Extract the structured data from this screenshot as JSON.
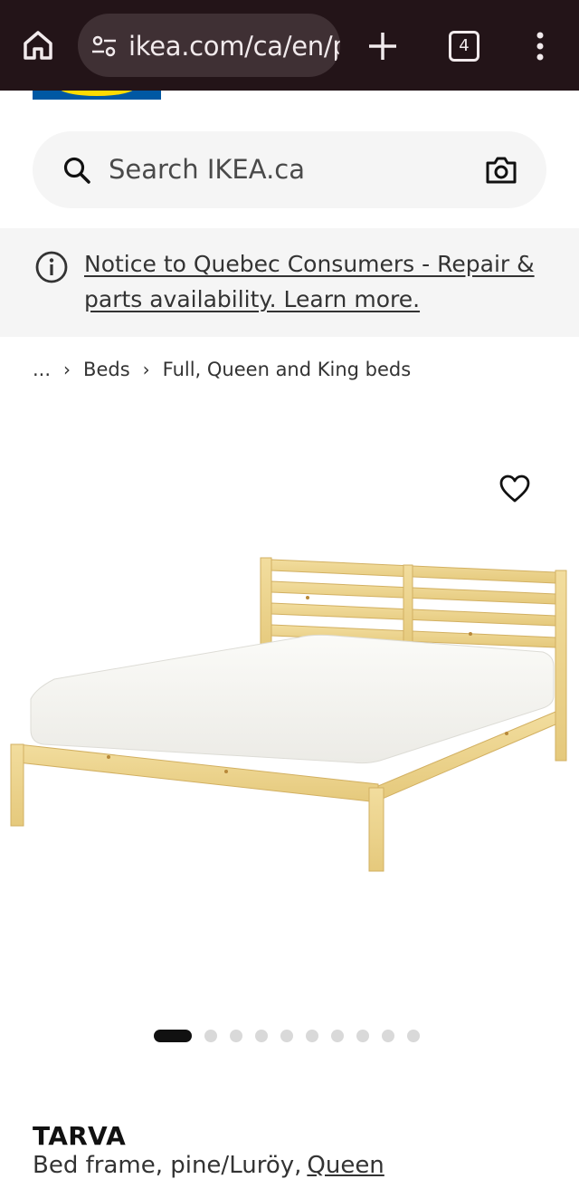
{
  "browser": {
    "url": "ikea.com/ca/en/p",
    "tab_count": "4"
  },
  "search": {
    "placeholder": "Search IKEA.ca"
  },
  "notice": {
    "text": "Notice to Quebec Consumers - Repair & parts availability. Learn more."
  },
  "breadcrumb": {
    "ellipsis": "...",
    "items": [
      "Beds",
      "Full, Queen and King beds"
    ]
  },
  "carousel": {
    "total": 10,
    "active_index": 0
  },
  "product": {
    "name": "TARVA",
    "description": "Bed frame, pine/Luröy,",
    "size": "Queen"
  },
  "colors": {
    "chrome_bg": "#231418",
    "urlbar_bg": "#3f3034",
    "ikea_blue": "#0058a3",
    "ikea_yellow": "#ffdb00"
  }
}
